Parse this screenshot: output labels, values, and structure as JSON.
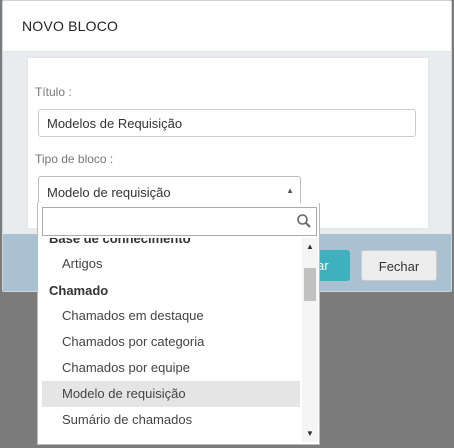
{
  "modal": {
    "title": "NOVO BLOCO",
    "fields": {
      "title_label": "Título :",
      "title_value": "Modelos de Requisição",
      "type_label": "Tipo de bloco :",
      "type_value": "Modelo de requisição"
    },
    "footer": {
      "primary_partial": "ar",
      "close_label": "Fechar"
    }
  },
  "dropdown": {
    "search_value": "",
    "partial_group": "Base de conhecimento",
    "items": [
      {
        "kind": "option",
        "label": "Artigos"
      },
      {
        "kind": "group",
        "label": "Chamado"
      },
      {
        "kind": "option",
        "label": "Chamados em destaque"
      },
      {
        "kind": "option",
        "label": "Chamados por categoria"
      },
      {
        "kind": "option",
        "label": "Chamados por equipe"
      },
      {
        "kind": "option",
        "label": "Modelo de requisição",
        "selected": true
      },
      {
        "kind": "option",
        "label": "Sumário de chamados"
      }
    ]
  },
  "colors": {
    "primary_button": "#3fb0bd",
    "footer_bg": "#a9c1d0",
    "selected_option_bg": "#e5e5e5"
  }
}
